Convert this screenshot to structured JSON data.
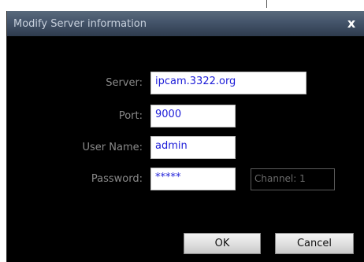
{
  "dialog": {
    "title": "Modify Server information",
    "close_symbol": "x"
  },
  "form": {
    "server": {
      "label": "Server:",
      "value": "ipcam.3322.org"
    },
    "port": {
      "label": "Port:",
      "value": "9000"
    },
    "username": {
      "label": "User Name:",
      "value": "admin"
    },
    "password": {
      "label": "Password:",
      "value": "*****"
    },
    "channel": {
      "text": "Channel: 1"
    }
  },
  "buttons": {
    "ok": "OK",
    "cancel": "Cancel"
  },
  "icons": {
    "close": "close-icon"
  },
  "colors": {
    "field_text": "#1c1cd8",
    "label_text": "#8a8a8a",
    "dialog_bg": "#000000",
    "titlebar": "#44546a"
  }
}
